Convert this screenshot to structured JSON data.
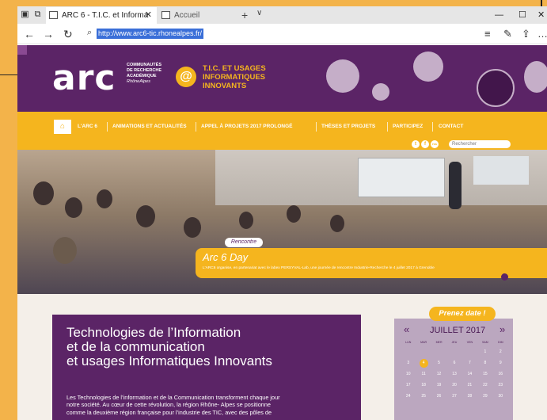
{
  "browser": {
    "tabs": [
      {
        "label": "ARC 6 - T.I.C. et Informa",
        "active": true
      },
      {
        "label": "Accueil",
        "active": false
      }
    ],
    "url": "http://www.arc6-tic.rhonealpes.fr/"
  },
  "header": {
    "logo": "arc",
    "logo_sub": [
      "COMMUNAUTÉS",
      "DE RECHERCHE",
      "ACADÉMIQUE",
      "RhôneAlpes"
    ],
    "at_symbol": "@",
    "tagline": [
      "T.I.C. ET USAGES",
      "INFORMATIQUES",
      "INNOVANTS"
    ]
  },
  "nav": {
    "items": [
      "L'ARC 6",
      "ANIMATIONS ET ACTUALITÉS",
      "APPEL À PROJETS 2017 PROLONGÉ",
      "THÈSES ET PROJETS",
      "PARTICIPEZ",
      "CONTACT"
    ],
    "search_placeholder": "Rechercher",
    "social": [
      "t",
      "f",
      "rss"
    ]
  },
  "hero": {
    "tag": "Rencontre",
    "title": "Arc 6 Day",
    "desc": "L'ARC6 organise, en partenariat avec le labex PERSYVAL-Lab, une journée de rencontre Industrie-Recherche le 4 juillet 2017 à Grenoble"
  },
  "main": {
    "title_lines": [
      "Technologies de l’Information",
      "et de la communication",
      "et usages Informatiques Innovants"
    ],
    "body_lines": [
      "Les Technologies de l’information et de la Communication transforment chaque jour",
      "notre société. Au cœur de cette révolution, la région Rhône- Alpes se positionne",
      "comme la deuxième région française pour l’industrie des TIC, avec des pôles de"
    ]
  },
  "calendar": {
    "badge": "Prenez date !",
    "prev": "«",
    "next": "»",
    "month": "JUILLET 2017",
    "day_headers": [
      "LUN",
      "MAR",
      "MER",
      "JEU",
      "VEN",
      "SAM",
      "DIM"
    ],
    "days": [
      "",
      "",
      "",
      "",
      "",
      "1",
      "2",
      "3",
      "4",
      "5",
      "6",
      "7",
      "8",
      "9",
      "10",
      "11",
      "12",
      "13",
      "14",
      "15",
      "16",
      "17",
      "18",
      "19",
      "20",
      "21",
      "22",
      "23",
      "24",
      "25",
      "26",
      "27",
      "28",
      "29",
      "30"
    ],
    "highlighted_day": "4"
  },
  "colors": {
    "purple": "#5b2466",
    "yellow": "#f5b51e",
    "calendar_bg": "#bba7bf"
  }
}
